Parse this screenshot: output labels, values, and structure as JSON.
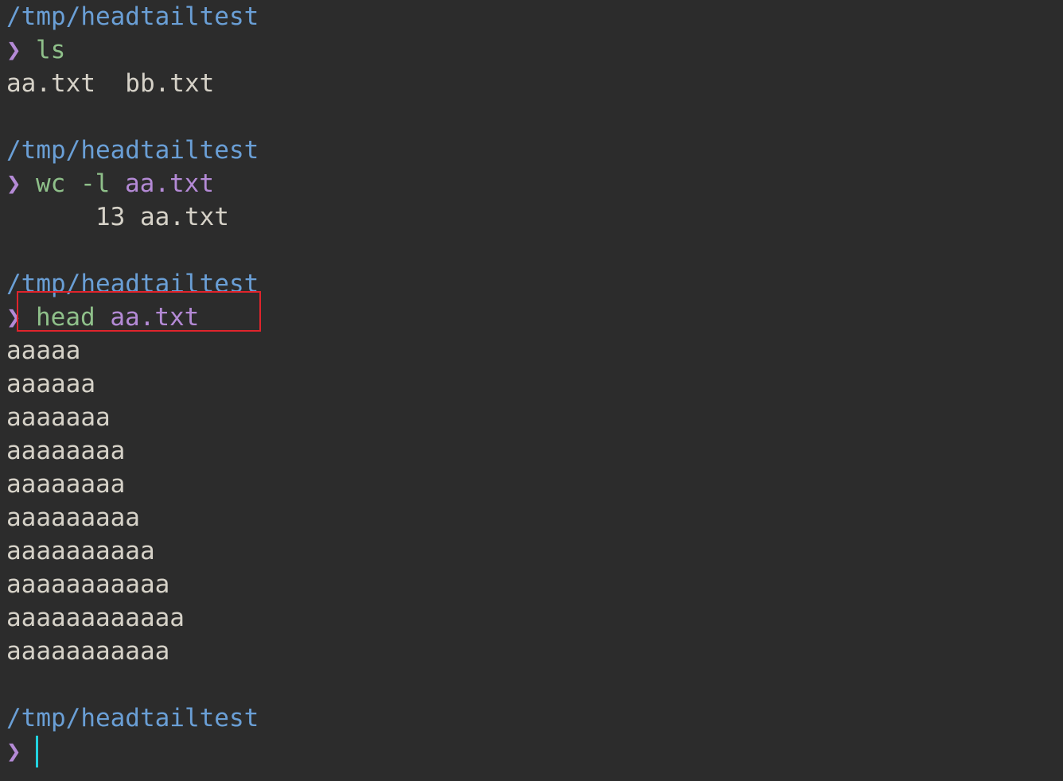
{
  "colors": {
    "background": "#2c2c2c",
    "path": "#6a9fd6",
    "prompt": "#b48ad6",
    "command": "#8fc08a",
    "argument": "#b48ad6",
    "output": "#d6d2c8",
    "cursor": "#22d3e0",
    "highlight": "#e0242c"
  },
  "prompt_symbol": "❯",
  "blocks": [
    {
      "path": "/tmp/headtailtest",
      "command": "ls",
      "args": "",
      "output": [
        "aa.txt  bb.txt"
      ]
    },
    {
      "path": "/tmp/headtailtest",
      "command": "wc -l",
      "args": "aa.txt",
      "output": [
        "      13 aa.txt"
      ]
    },
    {
      "path": "/tmp/headtailtest",
      "command": "head",
      "args": "aa.txt",
      "output": [
        "aaaaa",
        "aaaaaa",
        "aaaaaaa",
        "aaaaaaaa",
        "aaaaaaaa",
        "aaaaaaaaa",
        "aaaaaaaaaa",
        "aaaaaaaaaaa",
        "aaaaaaaaaaaa",
        "aaaaaaaaaaa"
      ]
    }
  ],
  "final_prompt": {
    "path": "/tmp/headtailtest"
  }
}
